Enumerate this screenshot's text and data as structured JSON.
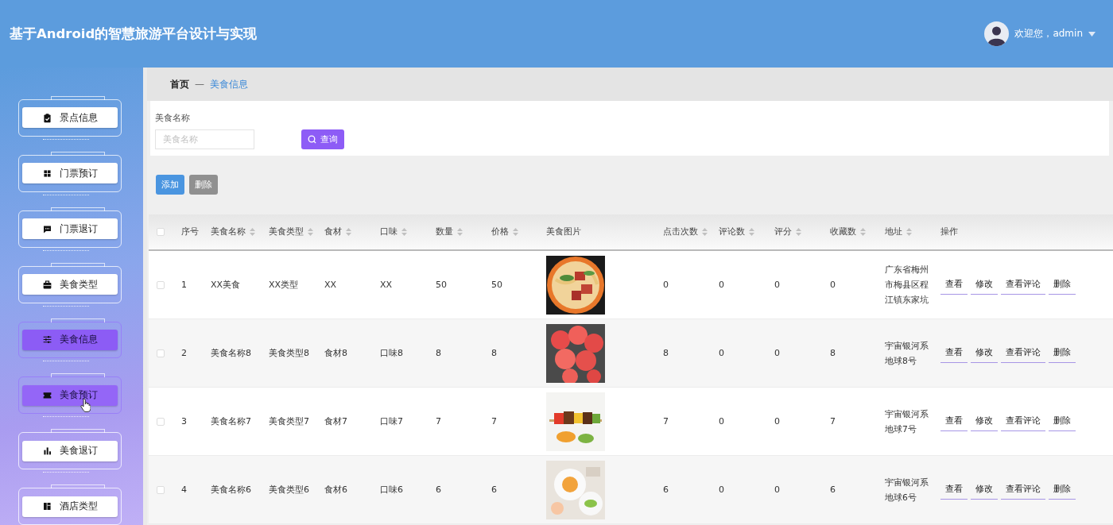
{
  "header": {
    "title": "基于Android的智慧旅游平台设计与实现",
    "user_greeting": "欢迎您，admin"
  },
  "sidebar": {
    "items": [
      {
        "label": "景点信息",
        "selected": false,
        "hovered": false
      },
      {
        "label": "门票预订",
        "selected": false,
        "hovered": false
      },
      {
        "label": "门票退订",
        "selected": false,
        "hovered": false
      },
      {
        "label": "美食类型",
        "selected": false,
        "hovered": false
      },
      {
        "label": "美食信息",
        "selected": true,
        "hovered": false
      },
      {
        "label": "美食预订",
        "selected": false,
        "hovered": true
      },
      {
        "label": "美食退订",
        "selected": false,
        "hovered": false
      },
      {
        "label": "酒店类型",
        "selected": false,
        "hovered": false
      }
    ]
  },
  "breadcrumb": {
    "home": "首页",
    "separator": "—",
    "current": "美食信息"
  },
  "search": {
    "label": "美食名称",
    "placeholder": "美食名称",
    "button": "查询"
  },
  "toolbar": {
    "add": "添加",
    "delete": "删除"
  },
  "table": {
    "select_all_checked": false,
    "columns": [
      {
        "label": "序号",
        "sortable": false
      },
      {
        "label": "美食名称",
        "sortable": true
      },
      {
        "label": "美食类型",
        "sortable": true
      },
      {
        "label": "食材",
        "sortable": true
      },
      {
        "label": "口味",
        "sortable": true
      },
      {
        "label": "数量",
        "sortable": true
      },
      {
        "label": "价格",
        "sortable": true
      },
      {
        "label": "美食图片",
        "sortable": false
      },
      {
        "label": "点击次数",
        "sortable": true
      },
      {
        "label": "评论数",
        "sortable": true
      },
      {
        "label": "评分",
        "sortable": true
      },
      {
        "label": "收藏数",
        "sortable": true
      },
      {
        "label": "地址",
        "sortable": true
      },
      {
        "label": "操作",
        "sortable": false
      }
    ],
    "rows": [
      {
        "checked": false,
        "cells": [
          "1",
          "XX美食",
          "XX类型",
          "XX",
          "XX",
          "50",
          "50"
        ],
        "image": {
          "kind": "picture"
        },
        "stats": [
          "0",
          "0",
          "0",
          "0"
        ],
        "address": "广东省梅州市梅县区程江镇东家坑",
        "actions": [
          "查看",
          "修改",
          "查看评论",
          "删除"
        ]
      },
      {
        "checked": false,
        "cells": [
          "2",
          "美食名称8",
          "美食类型8",
          "食材8",
          "口味8",
          "8",
          "8"
        ],
        "image": {
          "kind": "picture"
        },
        "stats": [
          "8",
          "0",
          "0",
          "8"
        ],
        "address": "宇宙银河系地球8号",
        "actions": [
          "查看",
          "修改",
          "查看评论",
          "删除"
        ]
      },
      {
        "checked": false,
        "cells": [
          "3",
          "美食名称7",
          "美食类型7",
          "食材7",
          "口味7",
          "7",
          "7"
        ],
        "image": {
          "kind": "picture"
        },
        "stats": [
          "7",
          "0",
          "0",
          "7"
        ],
        "address": "宇宙银河系地球7号",
        "actions": [
          "查看",
          "修改",
          "查看评论",
          "删除"
        ]
      },
      {
        "checked": false,
        "cells": [
          "4",
          "美食名称6",
          "美食类型6",
          "食材6",
          "口味6",
          "6",
          "6"
        ],
        "image": {
          "kind": "picture"
        },
        "stats": [
          "6",
          "0",
          "0",
          "6"
        ],
        "address": "宇宙银河系地球6号",
        "actions": [
          "查看",
          "修改",
          "查看评论",
          "删除"
        ]
      }
    ]
  }
}
